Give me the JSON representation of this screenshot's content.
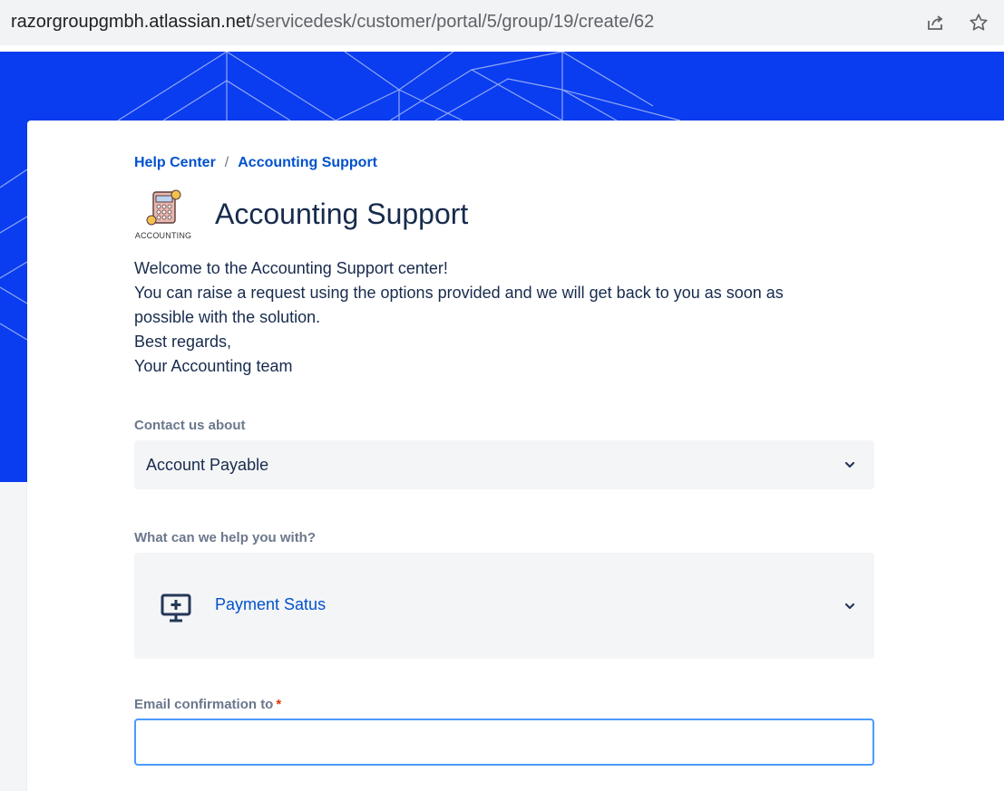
{
  "browser": {
    "url_host": "razorgroupgmbh.atlassian.net",
    "url_path": "/servicedesk/customer/portal/5/group/19/create/62",
    "icons": [
      "share-icon",
      "star-icon"
    ]
  },
  "breadcrumb": {
    "items": [
      "Help Center",
      "Accounting Support"
    ],
    "separator": "/"
  },
  "portal": {
    "logo_text": "ACCOUNTING",
    "title": "Accounting Support",
    "description": [
      "Welcome to the Accounting Support center!",
      "You can raise a request using the options provided and we will get back to you as soon as possible with the solution.",
      "Best regards,",
      "Your Accounting team"
    ]
  },
  "form": {
    "contact_label": "Contact us about",
    "contact_value": "Account Payable",
    "help_label": "What can we help you with?",
    "help_value": "Payment Satus",
    "help_icon": "monitor-plus-icon",
    "email_label": "Email confirmation to",
    "email_required_mark": "*",
    "email_value": ""
  },
  "colors": {
    "banner": "#0a3cf0",
    "link": "#0052cc",
    "text": "#172b4d",
    "label": "#6b778c",
    "required": "#de350b",
    "focus_border": "#4c9aff"
  }
}
